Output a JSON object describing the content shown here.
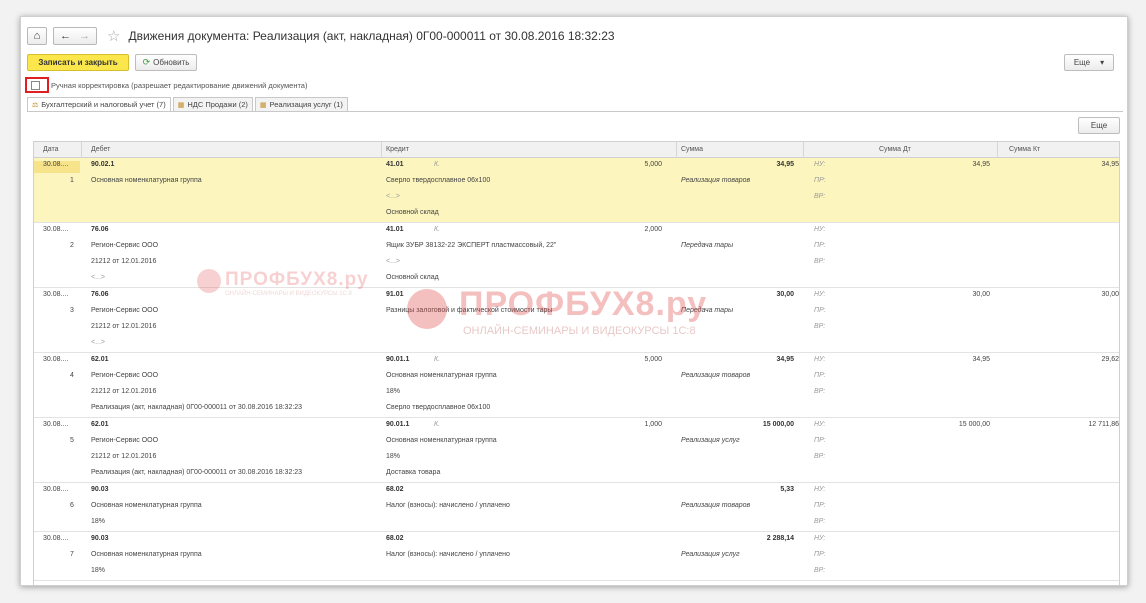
{
  "header": {
    "title": "Движения документа: Реализация (акт, накладная) 0Г00-000011 от 30.08.2016 18:32:23",
    "home_icon": "home-icon",
    "back_icon": "arrow-left-icon",
    "forward_icon": "arrow-right-icon",
    "star_icon": "star-icon"
  },
  "toolbar": {
    "save_close": "Записать и закрыть",
    "refresh": "Обновить",
    "more": "Еще"
  },
  "manual": {
    "label": "Ручная корректировка (разрешает редактирование движений документа)",
    "checked": false
  },
  "tabs": [
    {
      "label": "Бухгалтерский и налоговый учет (7)",
      "active": true
    },
    {
      "label": "НДС Продажи (2)",
      "active": false
    },
    {
      "label": "Реализация услуг (1)",
      "active": false
    }
  ],
  "table_more": "Еще",
  "columns": [
    "Дата",
    "Дебет",
    "Кредит",
    "Сумма",
    "Сумма Дт",
    "Сумма Кт"
  ],
  "rows": [
    {
      "date": "30.08....",
      "num": "1",
      "debit": [
        "90.02.1",
        "Основная номенклатурная группа",
        "",
        ""
      ],
      "credit": [
        "41.01",
        "Сверло твердосплавное 06х100",
        "<...>",
        "Основной склад"
      ],
      "k": "К.",
      "qty": "5,000",
      "sum": "34,95",
      "content": "Реализация товаров",
      "sum_dt": "34,95",
      "sum_kt": "34,95",
      "tax": [
        "НУ:",
        "ПР:",
        "ВР:"
      ],
      "selected": true
    },
    {
      "date": "30.08....",
      "num": "2",
      "debit": [
        "76.06",
        "Регион-Сервис ООО",
        "21212 от 12.01.2016",
        "<...>"
      ],
      "credit": [
        "41.01",
        "Ящик ЗУБР 38132-22 ЭКСПЕРТ пластмассовый, 22\"",
        "<...>",
        "Основной склад"
      ],
      "k": "К.",
      "qty": "2,000",
      "sum": "",
      "content": "Передача тары",
      "sum_dt": "",
      "sum_kt": "",
      "tax": [
        "НУ:",
        "ПР:",
        "ВР:"
      ],
      "selected": false
    },
    {
      "date": "30.08....",
      "num": "3",
      "debit": [
        "76.06",
        "Регион-Сервис ООО",
        "21212 от 12.01.2016",
        "<...>"
      ],
      "credit": [
        "91.01",
        "Разницы залоговой и фактической стоимости тары",
        "",
        ""
      ],
      "k": "",
      "qty": "",
      "sum": "30,00",
      "content": "Передача тары",
      "sum_dt": "30,00",
      "sum_kt": "30,00",
      "tax": [
        "НУ:",
        "ПР:",
        "ВР:"
      ],
      "selected": false
    },
    {
      "date": "30.08....",
      "num": "4",
      "debit": [
        "62.01",
        "Регион-Сервис ООО",
        "21212 от 12.01.2016",
        "Реализация (акт, накладная) 0Г00-000011 от 30.08.2016 18:32:23"
      ],
      "credit": [
        "90.01.1",
        "Основная номенклатурная группа",
        "18%",
        "Сверло твердосплавное 06х100"
      ],
      "k": "К.",
      "qty": "5,000",
      "sum": "34,95",
      "content": "Реализация товаров",
      "sum_dt": "34,95",
      "sum_kt": "29,62",
      "tax": [
        "НУ:",
        "ПР:",
        "ВР:"
      ],
      "selected": false
    },
    {
      "date": "30.08....",
      "num": "5",
      "debit": [
        "62.01",
        "Регион-Сервис ООО",
        "21212 от 12.01.2016",
        "Реализация (акт, накладная) 0Г00-000011 от 30.08.2016 18:32:23"
      ],
      "credit": [
        "90.01.1",
        "Основная номенклатурная группа",
        "18%",
        "Доставка товара"
      ],
      "k": "К.",
      "qty": "1,000",
      "sum": "15 000,00",
      "content": "Реализация услуг",
      "sum_dt": "15 000,00",
      "sum_kt": "12 711,86",
      "tax": [
        "НУ:",
        "ПР:",
        "ВР:"
      ],
      "selected": false
    },
    {
      "date": "30.08....",
      "num": "6",
      "debit": [
        "90.03",
        "Основная номенклатурная группа",
        "18%",
        ""
      ],
      "credit": [
        "68.02",
        "Налог (взносы): начислено / уплачено",
        "",
        ""
      ],
      "k": "",
      "qty": "",
      "sum": "5,33",
      "content": "Реализация товаров",
      "sum_dt": "",
      "sum_kt": "",
      "tax": [
        "НУ:",
        "ПР:",
        "ВР:"
      ],
      "selected": false
    },
    {
      "date": "30.08....",
      "num": "7",
      "debit": [
        "90.03",
        "Основная номенклатурная группа",
        "18%",
        ""
      ],
      "credit": [
        "68.02",
        "Налог (взносы): начислено / уплачено",
        "",
        ""
      ],
      "k": "",
      "qty": "",
      "sum": "2 288,14",
      "content": "Реализация услуг",
      "sum_dt": "",
      "sum_kt": "",
      "tax": [
        "НУ:",
        "ПР:",
        "ВР:"
      ],
      "selected": false
    }
  ],
  "watermark": {
    "name": "ПРОФБУХ8.ру",
    "sub_small": "ОНЛАЙН-СЕМИНАРЫ И ВИДЕОКУРСЫ 1С:8",
    "sub": "ОНЛАЙН-СЕМИНАРЫ И ВИДЕОКУРСЫ 1С:8"
  },
  "colors": {
    "primary_button": "#fbe64c",
    "selected_row": "#fdf5be",
    "highlight": "#e02020"
  }
}
